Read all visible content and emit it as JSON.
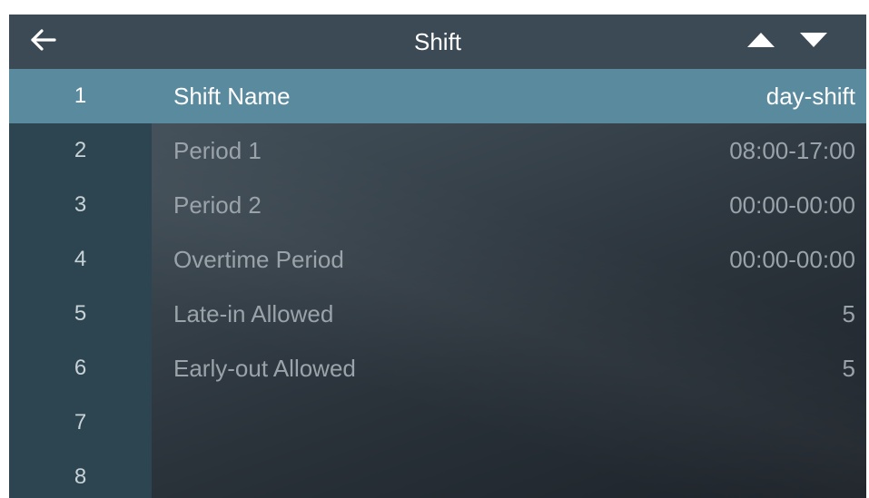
{
  "header": {
    "title": "Shift",
    "back_icon": "arrow-left-icon",
    "up_icon": "triangle-up-icon",
    "down_icon": "triangle-down-icon"
  },
  "colors": {
    "header_bg": "#3b4a54",
    "sidebar_bg": "#2c4550",
    "selected_row_bg": "#5a8a9e",
    "text_dim": "#9aa3a9",
    "text_bright": "#ffffff"
  },
  "rows": [
    {
      "num": "1",
      "label": "Shift Name",
      "value": "day-shift",
      "selected": true
    },
    {
      "num": "2",
      "label": "Period 1",
      "value": "08:00-17:00"
    },
    {
      "num": "3",
      "label": "Period 2",
      "value": "00:00-00:00"
    },
    {
      "num": "4",
      "label": "Overtime Period",
      "value": "00:00-00:00"
    },
    {
      "num": "5",
      "label": "Late-in Allowed",
      "value": "5"
    },
    {
      "num": "6",
      "label": "Early-out Allowed",
      "value": "5"
    },
    {
      "num": "7",
      "label": "",
      "value": ""
    },
    {
      "num": "8",
      "label": "",
      "value": ""
    }
  ]
}
